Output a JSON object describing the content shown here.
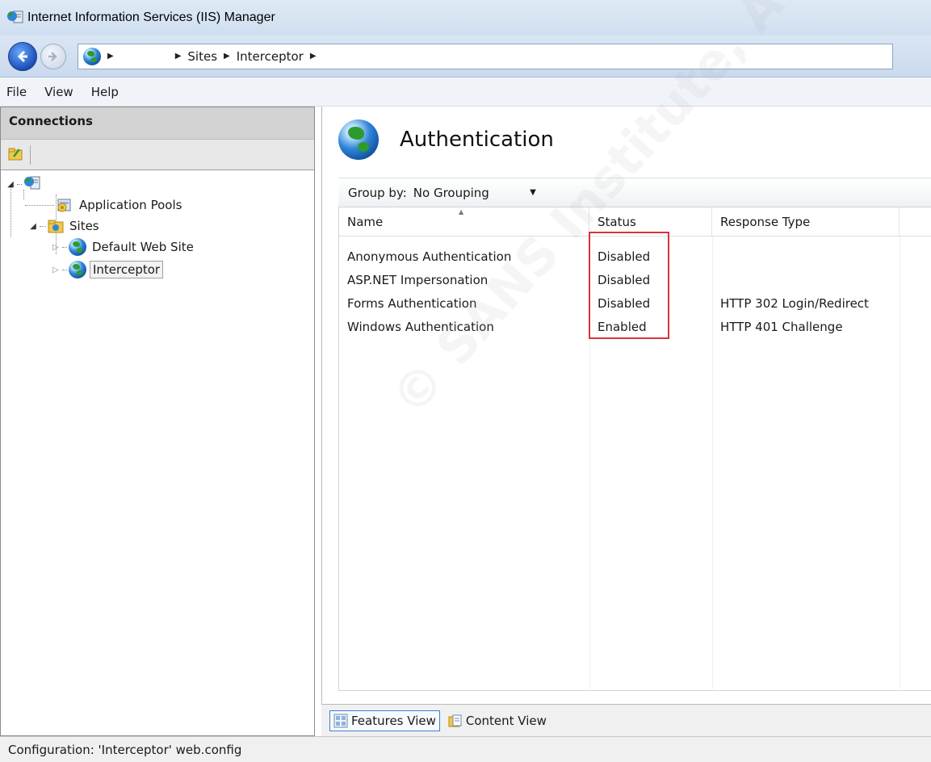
{
  "window": {
    "title": "Internet Information Services (IIS) Manager"
  },
  "address_bar": {
    "crumbs": [
      "Sites",
      "Interceptor"
    ]
  },
  "menu": {
    "items": [
      "File",
      "View",
      "Help"
    ]
  },
  "connections": {
    "header": "Connections",
    "tree": {
      "app_pools": "Application Pools",
      "sites": "Sites",
      "default_site": "Default Web Site",
      "interceptor": "Interceptor"
    }
  },
  "feature": {
    "title": "Authentication",
    "group_by_label": "Group by:",
    "group_by_value": "No Grouping",
    "columns": [
      "Name",
      "Status",
      "Response Type"
    ],
    "rows": [
      {
        "name": "Anonymous Authentication",
        "status": "Disabled",
        "response_type": ""
      },
      {
        "name": "ASP.NET Impersonation",
        "status": "Disabled",
        "response_type": ""
      },
      {
        "name": "Forms Authentication",
        "status": "Disabled",
        "response_type": "HTTP 302 Login/Redirect"
      },
      {
        "name": "Windows Authentication",
        "status": "Enabled",
        "response_type": "HTTP 401 Challenge"
      }
    ]
  },
  "view_tabs": {
    "features": "Features View",
    "content": "Content View"
  },
  "status_bar": {
    "text": "Configuration: 'Interceptor' web.config"
  },
  "watermark": "© SANS Institute, Author retains full rights",
  "colors": {
    "highlight_box": "#d9343a",
    "titlebar": "#cfdff0",
    "connections_header": "#d2d2d2"
  }
}
